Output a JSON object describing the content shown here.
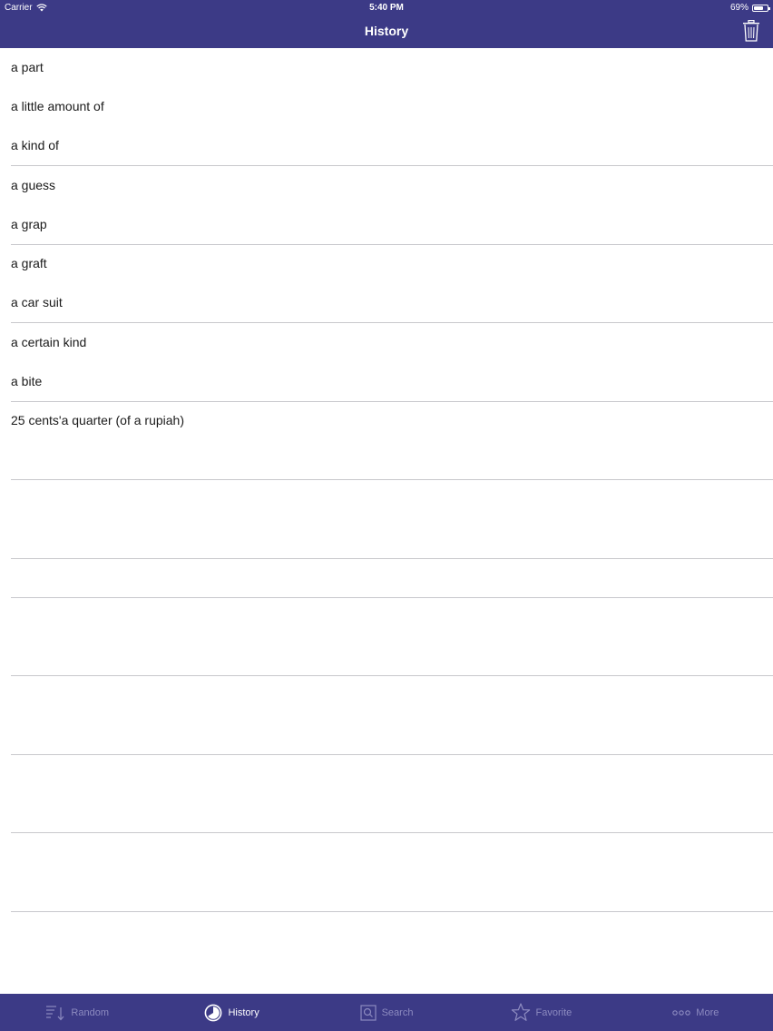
{
  "status_bar": {
    "carrier": "Carrier",
    "time": "5:40 PM",
    "battery": "69%",
    "battery_level": 0.69
  },
  "nav": {
    "title": "History",
    "trash_icon": "trash-icon"
  },
  "history": {
    "items": [
      "a part",
      "a little amount of",
      "a kind of",
      "a guess",
      "a grap",
      "a graft",
      "a car suit",
      "a certain kind",
      "a bite",
      "25 cents'a quarter (of a rupiah)"
    ]
  },
  "tabbar": {
    "tabs": [
      {
        "label": "Random",
        "icon": "random-list-icon",
        "active": false
      },
      {
        "label": "History",
        "icon": "clock-icon",
        "active": true
      },
      {
        "label": "Search",
        "icon": "search-icon",
        "active": false
      },
      {
        "label": "Favorite",
        "icon": "star-icon",
        "active": false
      },
      {
        "label": "More",
        "icon": "more-dots-icon",
        "active": false
      }
    ]
  },
  "colors": {
    "bar_background": "#3c3a86",
    "tab_active": "#ffffff",
    "tab_inactive": "#8d8bc0",
    "divider": "#c8c8cc"
  }
}
